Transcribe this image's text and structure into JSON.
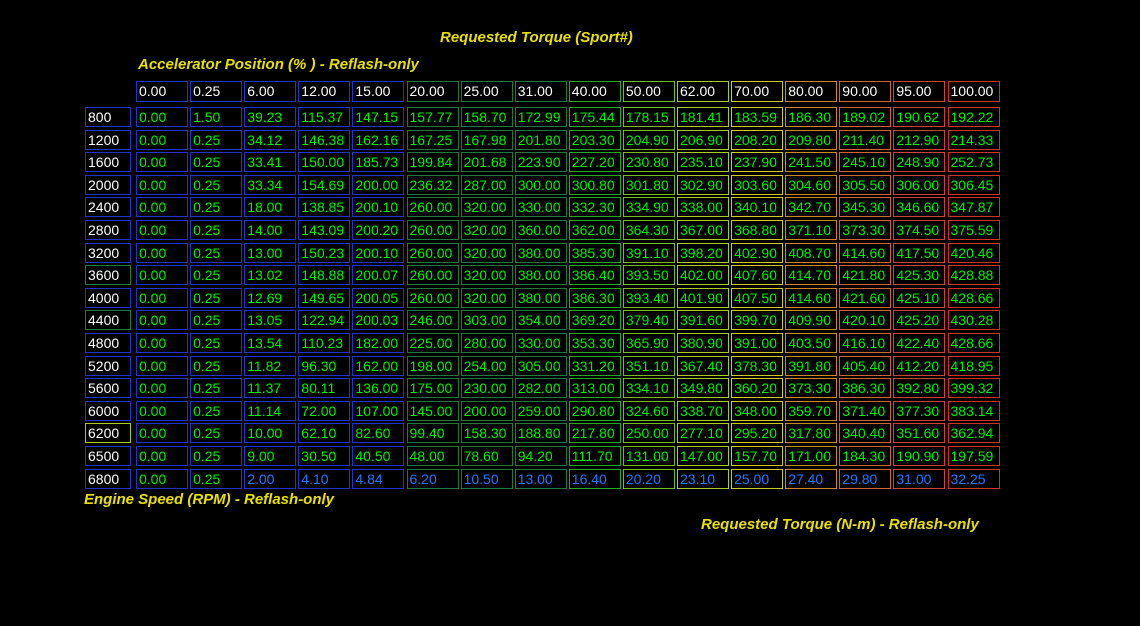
{
  "title": "Requested Torque (Sport#)",
  "x_axis_label": "Accelerator Position (% ) - Reflash-only",
  "y_axis_label": "Engine Speed (RPM) - Reflash-only",
  "z_label": "Requested Torque (N-m) - Reflash-only",
  "colors": {
    "label": "#e8e000",
    "value_green": "#00ee00",
    "value_blue": "#2277ff",
    "header_text": "#ffffff",
    "grid_blue": "#2233cc"
  },
  "col_headers": [
    "0.00",
    "0.25",
    "6.00",
    "12.00",
    "15.00",
    "20.00",
    "25.00",
    "31.00",
    "40.00",
    "50.00",
    "62.00",
    "70.00",
    "80.00",
    "90.00",
    "95.00",
    "100.00"
  ],
  "col_border_colors": [
    "#2233cc",
    "#2233cc",
    "#2233cc",
    "#2233cc",
    "#2233cc",
    "#1e7a3a",
    "#1e7a3a",
    "#1e7a3a",
    "#22aa22",
    "#77bb22",
    "#aacc22",
    "#cccc22",
    "#cc8822",
    "#cc6633",
    "#cc4433",
    "#cc3322"
  ],
  "row_headers": [
    "800",
    "1200",
    "1600",
    "2000",
    "2400",
    "2800",
    "3200",
    "3600",
    "4000",
    "4400",
    "4800",
    "5200",
    "5600",
    "6000",
    "6200",
    "6500",
    "6800"
  ],
  "row_border_colors": [
    "#2233cc",
    "#2233cc",
    "#2233cc",
    "#2233cc",
    "#2233cc",
    "#2233cc",
    "#2233cc",
    "#1e7a3a",
    "#2233cc",
    "#1e7a3a",
    "#2233cc",
    "#2233cc",
    "#2233cc",
    "#2233cc",
    "#aacc22",
    "#2233cc",
    "#2233cc"
  ],
  "rows": [
    [
      "0.00",
      "1.50",
      "39.23",
      "115.37",
      "147.15",
      "157.77",
      "158.70",
      "172.99",
      "175.44",
      "178.15",
      "181.41",
      "183.59",
      "186.30",
      "189.02",
      "190.62",
      "192.22"
    ],
    [
      "0.00",
      "0.25",
      "34.12",
      "146.38",
      "162.16",
      "167.25",
      "167.98",
      "201.80",
      "203.30",
      "204.90",
      "206.90",
      "208.20",
      "209.80",
      "211.40",
      "212.90",
      "214.33"
    ],
    [
      "0.00",
      "0.25",
      "33.41",
      "150.00",
      "185.73",
      "199.84",
      "201.68",
      "223.90",
      "227.20",
      "230.80",
      "235.10",
      "237.90",
      "241.50",
      "245.10",
      "248.90",
      "252.73"
    ],
    [
      "0.00",
      "0.25",
      "33.34",
      "154.69",
      "200.00",
      "236.32",
      "287.00",
      "300.00",
      "300.80",
      "301.80",
      "302.90",
      "303.60",
      "304.60",
      "305.50",
      "306.00",
      "306.45"
    ],
    [
      "0.00",
      "0.25",
      "18.00",
      "138.85",
      "200.10",
      "260.00",
      "320.00",
      "330.00",
      "332.30",
      "334.90",
      "338.00",
      "340.10",
      "342.70",
      "345.30",
      "346.60",
      "347.87"
    ],
    [
      "0.00",
      "0.25",
      "14.00",
      "143.09",
      "200.20",
      "260.00",
      "320.00",
      "360.00",
      "362.00",
      "364.30",
      "367.00",
      "368.80",
      "371.10",
      "373.30",
      "374.50",
      "375.59"
    ],
    [
      "0.00",
      "0.25",
      "13.00",
      "150.23",
      "200.10",
      "260.00",
      "320.00",
      "380.00",
      "385.30",
      "391.10",
      "398.20",
      "402.90",
      "408.70",
      "414.60",
      "417.50",
      "420.46"
    ],
    [
      "0.00",
      "0.25",
      "13.02",
      "148.88",
      "200.07",
      "260.00",
      "320.00",
      "380.00",
      "386.40",
      "393.50",
      "402.00",
      "407.60",
      "414.70",
      "421.80",
      "425.30",
      "428.88"
    ],
    [
      "0.00",
      "0.25",
      "12.69",
      "149.65",
      "200.05",
      "260.00",
      "320.00",
      "380.00",
      "386.30",
      "393.40",
      "401.90",
      "407.50",
      "414.60",
      "421.60",
      "425.10",
      "428.66"
    ],
    [
      "0.00",
      "0.25",
      "13.05",
      "122.94",
      "200.03",
      "246.00",
      "303.00",
      "354.00",
      "369.20",
      "379.40",
      "391.60",
      "399.70",
      "409.90",
      "420.10",
      "425.20",
      "430.28"
    ],
    [
      "0.00",
      "0.25",
      "13.54",
      "110.23",
      "182.00",
      "225.00",
      "280.00",
      "330.00",
      "353.30",
      "365.90",
      "380.90",
      "391.00",
      "403.50",
      "416.10",
      "422.40",
      "428.66"
    ],
    [
      "0.00",
      "0.25",
      "11.82",
      "96.30",
      "162.00",
      "198.00",
      "254.00",
      "305.00",
      "331.20",
      "351.10",
      "367.40",
      "378.30",
      "391.80",
      "405.40",
      "412.20",
      "418.95"
    ],
    [
      "0.00",
      "0.25",
      "11.37",
      "80.11",
      "136.00",
      "175.00",
      "230.00",
      "282.00",
      "313.00",
      "334.10",
      "349.80",
      "360.20",
      "373.30",
      "386.30",
      "392.80",
      "399.32"
    ],
    [
      "0.00",
      "0.25",
      "11.14",
      "72.00",
      "107.00",
      "145.00",
      "200.00",
      "259.00",
      "290.80",
      "324.60",
      "338.70",
      "348.00",
      "359.70",
      "371.40",
      "377.30",
      "383.14"
    ],
    [
      "0.00",
      "0.25",
      "10.00",
      "62.10",
      "82.60",
      "99.40",
      "158.30",
      "188.80",
      "217.80",
      "250.00",
      "277.10",
      "295.20",
      "317.80",
      "340.40",
      "351.60",
      "362.94"
    ],
    [
      "0.00",
      "0.25",
      "9.00",
      "30.50",
      "40.50",
      "48.00",
      "78.60",
      "94.20",
      "111.70",
      "131.00",
      "147.00",
      "157.70",
      "171.00",
      "184.30",
      "190.90",
      "197.59"
    ],
    [
      "0.00",
      "0.25",
      "2.00",
      "4.10",
      "4.84",
      "6.20",
      "10.50",
      "13.00",
      "16.40",
      "20.20",
      "23.10",
      "25.00",
      "27.40",
      "29.80",
      "31.00",
      "32.25"
    ]
  ]
}
